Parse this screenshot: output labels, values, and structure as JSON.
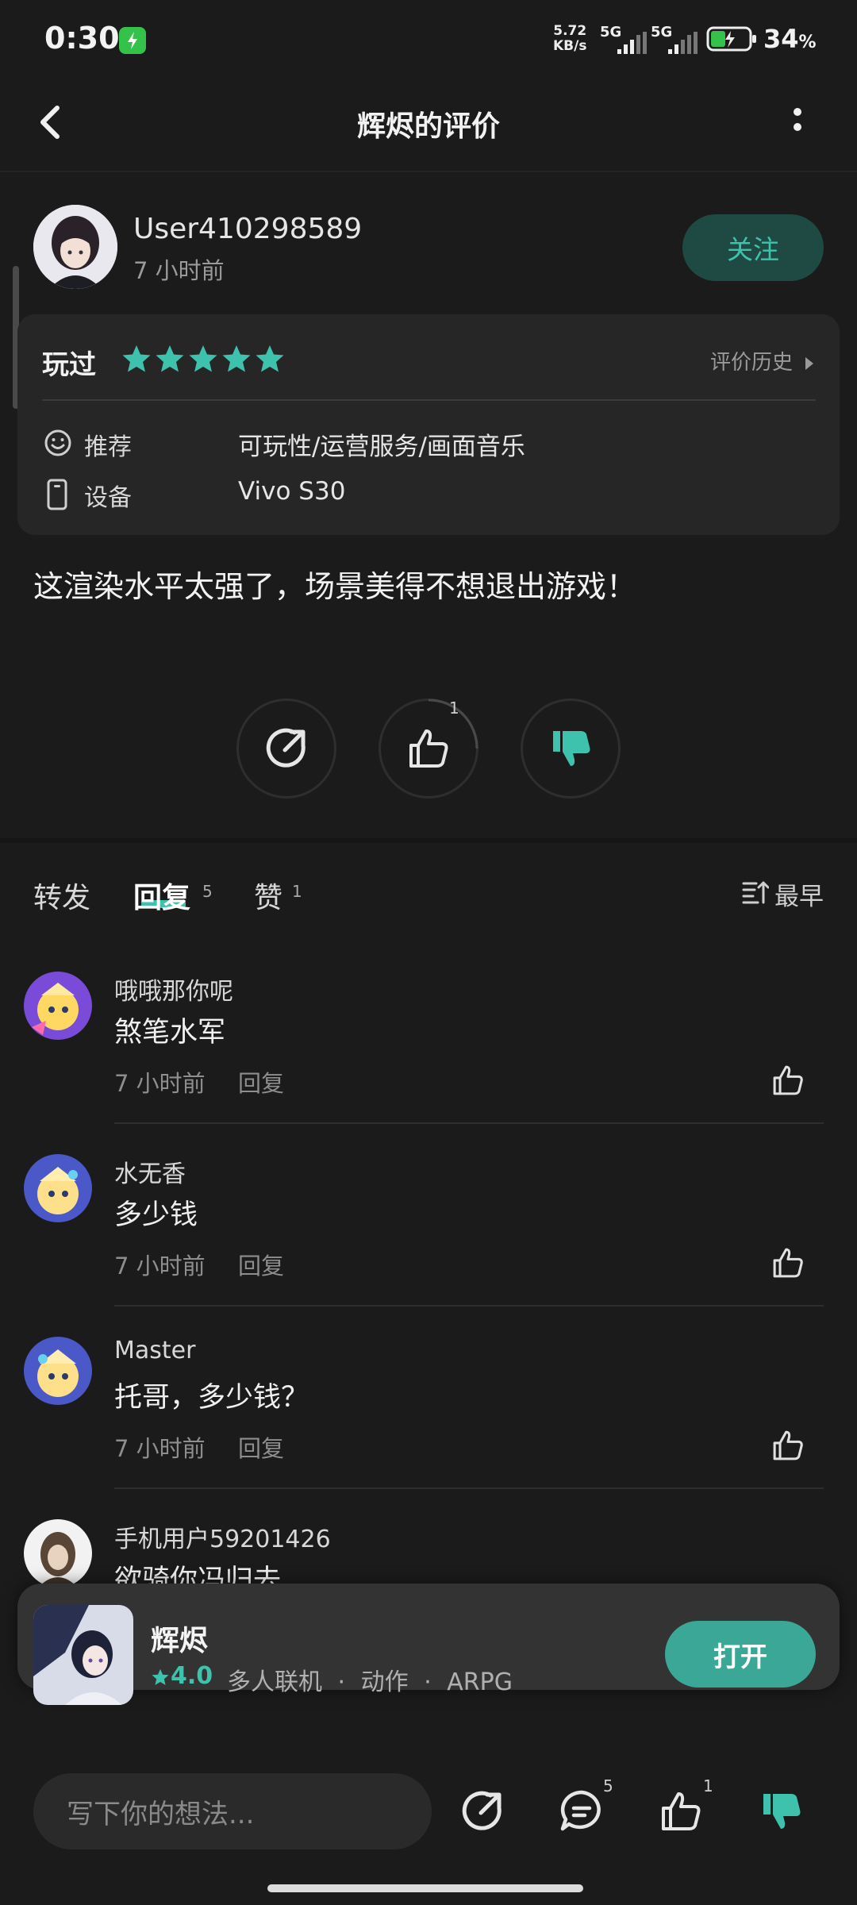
{
  "status_bar": {
    "time": "0:30",
    "net_speed_value": "5.72",
    "net_speed_unit": "KB/s",
    "sim1": "5G",
    "sim2": "5G",
    "battery_percent": "34",
    "battery_percent_sign": "%"
  },
  "header": {
    "title": "辉烬的评价",
    "back_icon": "chevron-left-icon",
    "more_icon": "more-vertical-icon"
  },
  "author": {
    "name": "User410298589",
    "time": "7 小时前",
    "follow_label": "关注"
  },
  "review_card": {
    "played_label": "玩过",
    "stars": 5,
    "history_label": "评价历史",
    "recommend_label": "推荐",
    "recommend_value": "可玩性/运营服务/画面音乐",
    "device_label": "设备",
    "device_value": "Vivo S30"
  },
  "review": {
    "text": "这渲染水平太强了，场景美得不想退出游戏！",
    "like_count": "1"
  },
  "tabs": {
    "forward_label": "转发",
    "reply_label": "回复",
    "reply_count": "5",
    "like_label": "赞",
    "like_count": "1",
    "sort_label": "最早"
  },
  "comments": [
    {
      "name": "哦哦那你呢",
      "text": "煞笔水军",
      "time": "7 小时前",
      "reply": "回复"
    },
    {
      "name": "水无香",
      "text": "多少钱",
      "time": "7 小时前",
      "reply": "回复"
    },
    {
      "name": "Master",
      "text": "托哥，多少钱？",
      "time": "7 小时前",
      "reply": "回复"
    },
    {
      "name": "手机用户59201426",
      "text": "欲骑你冯归去",
      "time": "",
      "reply": ""
    }
  ],
  "game": {
    "name": "辉烬",
    "rating": "4.0",
    "tag1": "多人联机",
    "tag2": "动作",
    "tag3": "ARPG",
    "tag_sep": "·",
    "open_label": "打开"
  },
  "bottom_bar": {
    "input_placeholder": "写下你的想法...",
    "comment_count": "5",
    "like_count": "1"
  },
  "colors": {
    "accent": "#3ec2ad",
    "background": "#1b1b1b",
    "card": "#262626"
  }
}
